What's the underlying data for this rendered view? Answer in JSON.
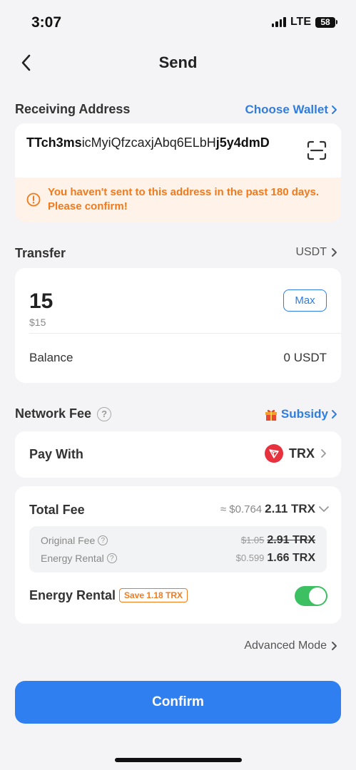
{
  "status": {
    "time": "3:07",
    "network": "LTE",
    "battery": "58"
  },
  "header": {
    "title": "Send"
  },
  "receiving": {
    "label": "Receiving Address",
    "choose_wallet": "Choose Wallet",
    "address_start": "TTch3ms",
    "address_middle": "icMyiQfzcaxjAbq6ELbH",
    "address_end": "j5y4dmD",
    "warning": "You haven't sent to this address in the past 180 days. Please confirm!"
  },
  "transfer": {
    "label": "Transfer",
    "token": "USDT",
    "amount": "15",
    "amount_usd": "$15",
    "max_label": "Max",
    "balance_label": "Balance",
    "balance_value": "0 USDT"
  },
  "network_fee": {
    "label": "Network Fee",
    "help": "?",
    "subsidy": "Subsidy",
    "pay_with_label": "Pay With",
    "pay_with_token": "TRX",
    "total_fee_label": "Total Fee",
    "total_fee_usd": "≈ $0.764",
    "total_fee_trx": "2.11 TRX",
    "original_fee_label": "Original Fee",
    "original_fee_usd": "$1.05",
    "original_fee_trx": "2.91 TRX",
    "energy_rental_small_label": "Energy Rental",
    "energy_rental_usd": "$0.599",
    "energy_rental_trx": "1.66 TRX",
    "energy_rental_label": "Energy Rental",
    "save_badge": "Save 1.18 TRX",
    "energy_rental_enabled": true
  },
  "advanced_mode": "Advanced Mode",
  "confirm_label": "Confirm",
  "colors": {
    "accent": "#2f7de1",
    "warning": "#f17a1c",
    "toggle_on": "#3cc062",
    "tron_red": "#e8313e"
  },
  "icons": [
    "back-icon",
    "chevron-right-icon",
    "scan-icon",
    "warning-icon",
    "help-icon",
    "gift-icon",
    "tron-logo-icon",
    "chevron-down-icon"
  ]
}
